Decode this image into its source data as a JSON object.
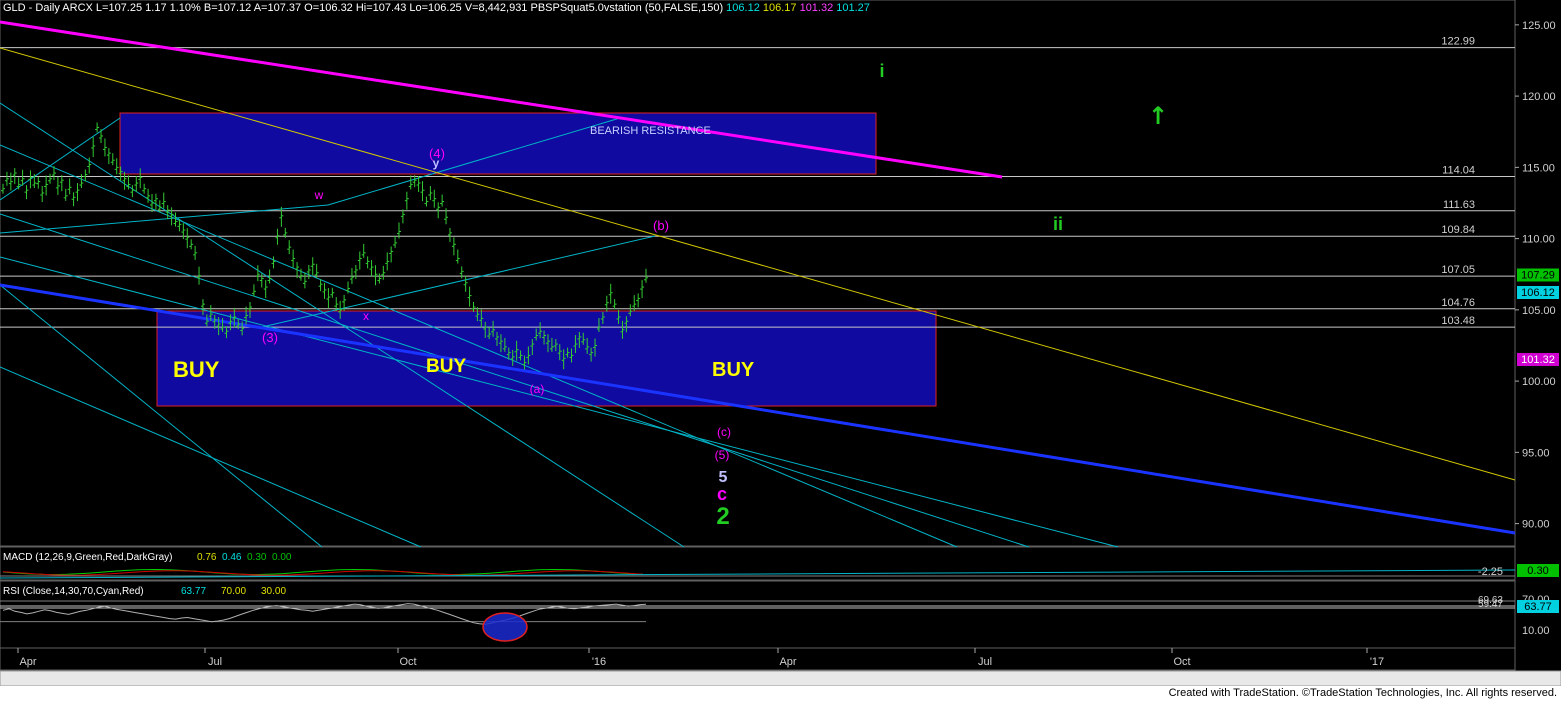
{
  "header": {
    "symbol_line": "GLD - Daily  ARCX  L=107.25  1.17  1.10%  B=107.12  A=107.37  O=106.32  Hi=107.43  Lo=106.25  V=8,442,931  PBSPSquat5.0vstation (50,FALSE,150)",
    "ind_values": [
      {
        "text": "106.12",
        "color": "#00e0e0"
      },
      {
        "text": "106.17",
        "color": "#e0e000"
      },
      {
        "text": "101.32",
        "color": "#ff40ff"
      },
      {
        "text": "101.27",
        "color": "#00e0e0"
      }
    ]
  },
  "footer": {
    "text": "Created with TradeStation. ©TradeStation Technologies, Inc. All rights reserved."
  },
  "chart_data": {
    "type": "line",
    "price_axis": {
      "ticks": [
        "125.00",
        "120.00",
        "115.00",
        "110.00",
        "105.00",
        "100.00",
        "95.00",
        "90.00"
      ],
      "ylim": [
        89,
        125.3
      ]
    },
    "time_axis": {
      "ticks": [
        "Apr",
        "Jul",
        "Oct",
        "'16",
        "Apr",
        "Jul",
        "Oct",
        "'17"
      ]
    },
    "price_series": [
      113.5,
      114.2,
      114.0,
      114.6,
      113.8,
      114.2,
      113.4,
      114.3,
      113.9,
      114.0,
      113.2,
      113.8,
      114.2,
      114.6,
      113.7,
      114.1,
      113.0,
      113.6,
      112.9,
      113.4,
      113.9,
      114.5,
      115.2,
      116.5,
      117.8,
      117.2,
      116.4,
      116.0,
      115.5,
      115.0,
      114.7,
      114.2,
      113.8,
      113.4,
      113.9,
      114.3,
      113.5,
      113.0,
      112.5,
      112.8,
      112.2,
      112.6,
      112.0,
      111.7,
      111.2,
      111.0,
      110.6,
      110.1,
      109.6,
      109.0,
      107.4,
      105.4,
      104.2,
      104.7,
      104.3,
      104.0,
      103.8,
      103.5,
      104.2,
      104.5,
      104.0,
      103.7,
      104.6,
      105.2,
      106.3,
      107.5,
      107.2,
      106.6,
      107.2,
      108.4,
      110.2,
      111.6,
      110.4,
      109.4,
      108.6,
      108.0,
      107.4,
      107.0,
      107.8,
      108.2,
      107.6,
      106.8,
      106.4,
      105.9,
      106.2,
      105.4,
      105.0,
      105.7,
      106.5,
      107.3,
      107.8,
      108.6,
      109.0,
      108.4,
      108.0,
      107.5,
      107.2,
      107.6,
      108.4,
      109.1,
      109.7,
      110.5,
      111.7,
      112.8,
      113.8,
      114.1,
      113.9,
      113.4,
      112.6,
      113.2,
      112.8,
      112.2,
      112.6,
      111.5,
      110.4,
      109.6,
      108.6,
      107.7,
      106.9,
      106.0,
      105.2,
      104.7,
      104.4,
      103.8,
      103.3,
      103.6,
      103.1,
      102.8,
      102.4,
      102.0,
      101.7,
      102.2,
      101.8,
      101.3,
      101.8,
      102.6,
      103.2,
      103.5,
      103.2,
      102.8,
      102.4,
      102.6,
      102.1,
      101.6,
      102.0,
      101.8,
      102.6,
      103.1,
      102.9,
      102.4,
      102.0,
      102.5,
      103.8,
      104.5,
      105.5,
      106.2,
      105.4,
      104.5,
      103.6,
      104.2,
      104.9,
      105.4,
      105.8,
      106.6,
      107.25
    ],
    "rsi_series": [
      52,
      55,
      50,
      48,
      45,
      47,
      50,
      53,
      51,
      48,
      46,
      44,
      47,
      50,
      52,
      55,
      58,
      60,
      57,
      54,
      52,
      50,
      48,
      46,
      44,
      42,
      40,
      38,
      36,
      35,
      37,
      38,
      36,
      34,
      32,
      30,
      31,
      33,
      36,
      40,
      44,
      48,
      52,
      55,
      58,
      60,
      61,
      59,
      57,
      55,
      53,
      52,
      50,
      52,
      54,
      56,
      58,
      60,
      62,
      64,
      63,
      60,
      58,
      56,
      57,
      59,
      61,
      63,
      65,
      64,
      61,
      58,
      55,
      52,
      48,
      44,
      40,
      36,
      32,
      28,
      26,
      25,
      27,
      30,
      32,
      35,
      38,
      42,
      46,
      50,
      54,
      56,
      58,
      60,
      58,
      56,
      55,
      57,
      58,
      60,
      61,
      62,
      63,
      64,
      62,
      60,
      61,
      63,
      63.77
    ],
    "horizontal_levels": [
      "122.99",
      "114.04",
      "111.63",
      "109.84",
      "107.05",
      "104.76",
      "103.48"
    ],
    "right_tags": [
      {
        "text": "107.29",
        "bg": "#00c000",
        "fg": "#000000"
      },
      {
        "text": "106.12",
        "bg": "#00d0e0",
        "fg": "#000000"
      },
      {
        "text": "101.32",
        "bg": "#d000d0",
        "fg": "#ffffff"
      }
    ],
    "zone_labels": [
      "BUY",
      "BUY",
      "BUY"
    ],
    "resistance_label": "BEARISH RESISTANCE",
    "wave_labels": {
      "magenta": [
        "(4)",
        "w",
        "(3)",
        "x",
        "(a)",
        "(b)",
        "(c)",
        "(5)",
        "c"
      ],
      "lavender": [
        "y",
        "5"
      ],
      "green": [
        "i",
        "ii",
        "2"
      ],
      "up_arrow": "↑"
    },
    "macd": {
      "label": "MACD (12,26,9,Green,Red,DarkGray)",
      "values": [
        "0.76",
        "0.46",
        "0.30",
        "0.00"
      ],
      "axis_value": "-2.25",
      "tag": "0.30"
    },
    "rsi": {
      "label": "RSI (Close,14,30,70,Cyan,Red)",
      "values": [
        "63.77",
        "70.00",
        "30.00"
      ],
      "axis_ticks": [
        "70.00",
        "10.00"
      ],
      "overlay_ticks": [
        "69.63",
        "59.47"
      ],
      "tag": "63.77"
    },
    "colors": {
      "bg": "#000000",
      "price": "#33cc33",
      "magenta": "#ff00ff",
      "blue_line": "#1a33ff",
      "cyan": "#00b4c8",
      "yellow": "#d2c800",
      "zone": "#100aa0",
      "label_yellow": "#ffff00",
      "green_label": "#22cc22"
    }
  }
}
